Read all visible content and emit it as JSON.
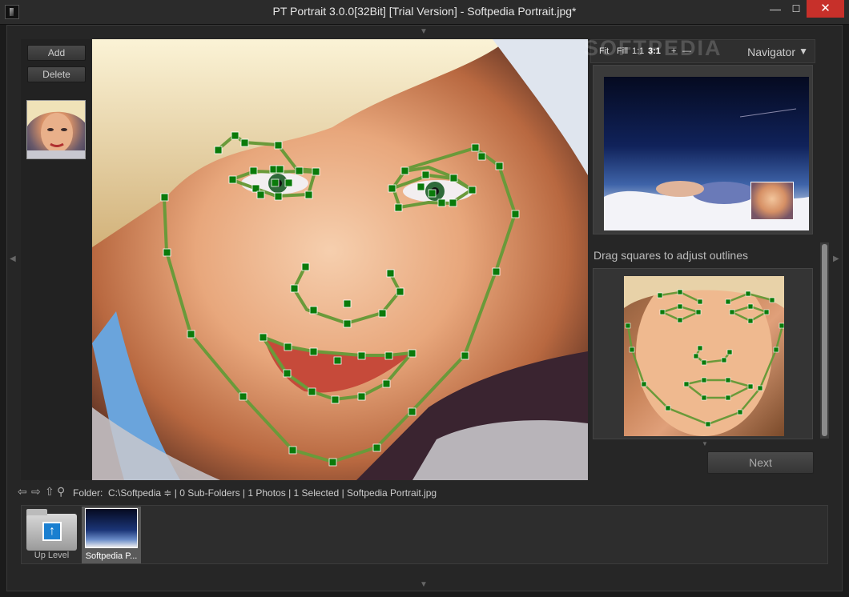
{
  "window": {
    "title": "PT Portrait 3.0.0[32Bit] [Trial Version] - Softpedia Portrait.jpg*",
    "minimize": "—",
    "maximize": "☐",
    "close": "✕"
  },
  "sidebar": {
    "add_label": "Add",
    "delete_label": "Delete"
  },
  "navigator": {
    "options": [
      "Fit",
      "Fill",
      "1:1",
      "3:1",
      "+",
      "—"
    ],
    "title": "Navigator",
    "watermark": "SOFTPEDIA"
  },
  "outline": {
    "hint": "Drag squares to adjust outlines"
  },
  "actions": {
    "next_label": "Next"
  },
  "folderbar": {
    "label": "Folder:",
    "path_info": "C:\\Softpedia ≑ | 0 Sub-Folders | 1 Photos | 1 Selected | Softpedia Portrait.jpg"
  },
  "filmstrip": {
    "up_level": "Up Level",
    "items": [
      {
        "label": "Softpedia P..."
      }
    ]
  },
  "colors": {
    "marker": "#0a7a0a",
    "outline": "#6a9a3a",
    "close": "#c7302a"
  }
}
